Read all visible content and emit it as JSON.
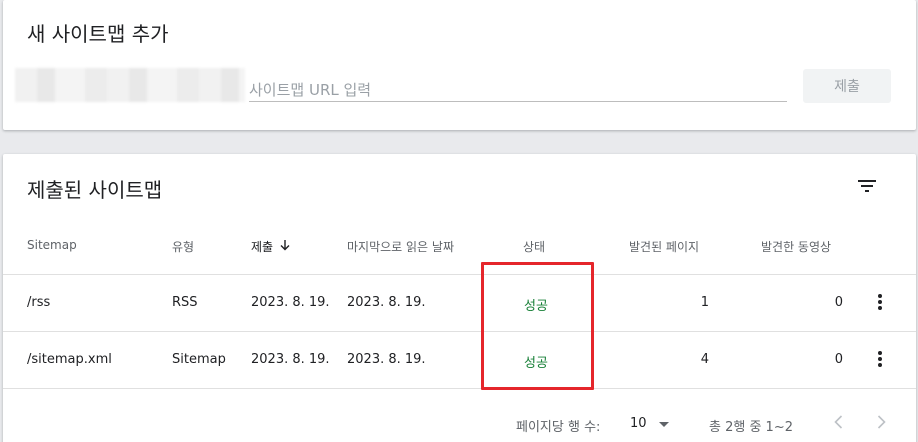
{
  "add_card": {
    "title": "새 사이트맵 추가",
    "url_placeholder": "사이트맵 URL 입력",
    "url_value": "",
    "submit_label": "제출"
  },
  "list_card": {
    "title": "제출된 사이트맵",
    "columns": {
      "sitemap": "Sitemap",
      "type": "유형",
      "submitted": "제출",
      "last_read": "마지막으로 읽은 날짜",
      "status": "상태",
      "pages": "발견된 페이지",
      "videos": "발견한 동영상"
    },
    "rows": [
      {
        "sitemap": "/rss",
        "type": "RSS",
        "submitted": "2023. 8. 19.",
        "last_read": "2023. 8. 19.",
        "status": "성공",
        "pages": "1",
        "videos": "0"
      },
      {
        "sitemap": "/sitemap.xml",
        "type": "Sitemap",
        "submitted": "2023. 8. 19.",
        "last_read": "2023. 8. 19.",
        "status": "성공",
        "pages": "4",
        "videos": "0"
      }
    ],
    "footer": {
      "rows_per_page_label": "페이지당 행 수:",
      "rows_per_page_value": "10",
      "range_text": "총 2행 중 1~2"
    }
  },
  "colors": {
    "status_success": "#188038",
    "highlight_box": "#e5262b"
  },
  "icons": [
    "filter-icon",
    "arrow-down-icon",
    "more-vert-icon",
    "dropdown-arrow-icon",
    "chevron-left-icon",
    "chevron-right-icon"
  ]
}
